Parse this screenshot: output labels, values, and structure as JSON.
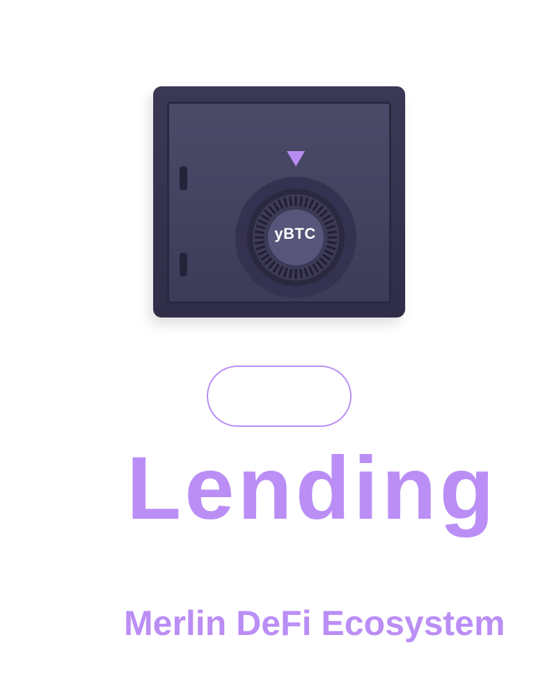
{
  "vault": {
    "token_label": "yBTC",
    "colors": {
      "body": "#3a3855",
      "door": "#4b4a68",
      "accent": "#b98cf4"
    },
    "icons": [
      "safe-icon",
      "dial-icon",
      "down-triangle-icon"
    ]
  },
  "cta": {
    "label": ""
  },
  "hero": {
    "title": "Lending",
    "subtitle": "Merlin DeFi Ecosystem"
  },
  "colors": {
    "accent": "#bb8ef6",
    "background": "#ffffff"
  }
}
